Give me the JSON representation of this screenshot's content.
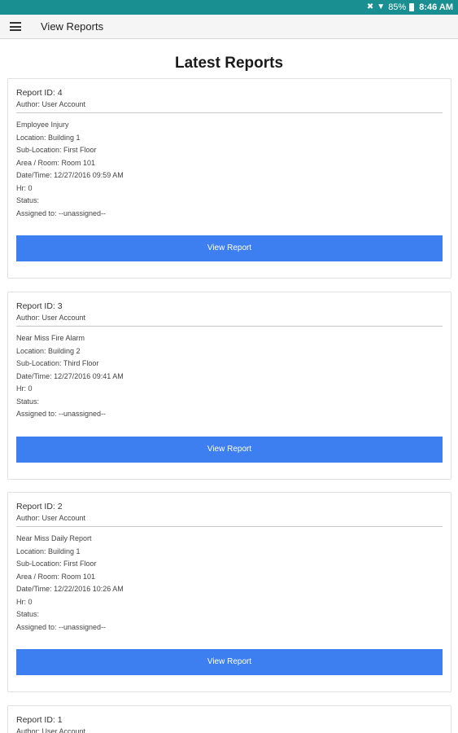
{
  "status_bar": {
    "battery": "85%",
    "time": "8:46 AM"
  },
  "app_bar": {
    "title": "View Reports"
  },
  "page": {
    "title": "Latest Reports"
  },
  "reports": [
    {
      "id": "Report ID: 4",
      "author": "Author: User Account",
      "lines": [
        "Employee Injury",
        "Location: Building 1",
        "Sub-Location: First Floor",
        "Area / Room: Room 101",
        "Date/Time: 12/27/2016 09:59 AM",
        "Hr: 0",
        "Status:",
        "Assigned to: --unassigned--"
      ],
      "button": "View Report"
    },
    {
      "id": "Report ID: 3",
      "author": "Author: User Account",
      "lines": [
        "Near Miss Fire Alarm",
        "Location: Building 2",
        "Sub-Location: Third Floor",
        "Date/Time: 12/27/2016 09:41 AM",
        "Hr: 0",
        "Status:",
        "Assigned to: --unassigned--"
      ],
      "button": "View Report"
    },
    {
      "id": "Report ID: 2",
      "author": "Author: User Account",
      "lines": [
        "Near Miss Daily Report",
        "Location: Building 1",
        "Sub-Location: First Floor",
        "Area / Room: Room 101",
        "Date/Time: 12/22/2016 10:26 AM",
        "Hr: 0",
        "Status:",
        "Assigned to: --unassigned--"
      ],
      "button": "View Report"
    },
    {
      "id": "Report ID: 1",
      "author": "Author: User Account",
      "lines": [],
      "button": ""
    }
  ],
  "colors": {
    "status_bar": "#1a8f92",
    "button": "#3d7ff0"
  }
}
